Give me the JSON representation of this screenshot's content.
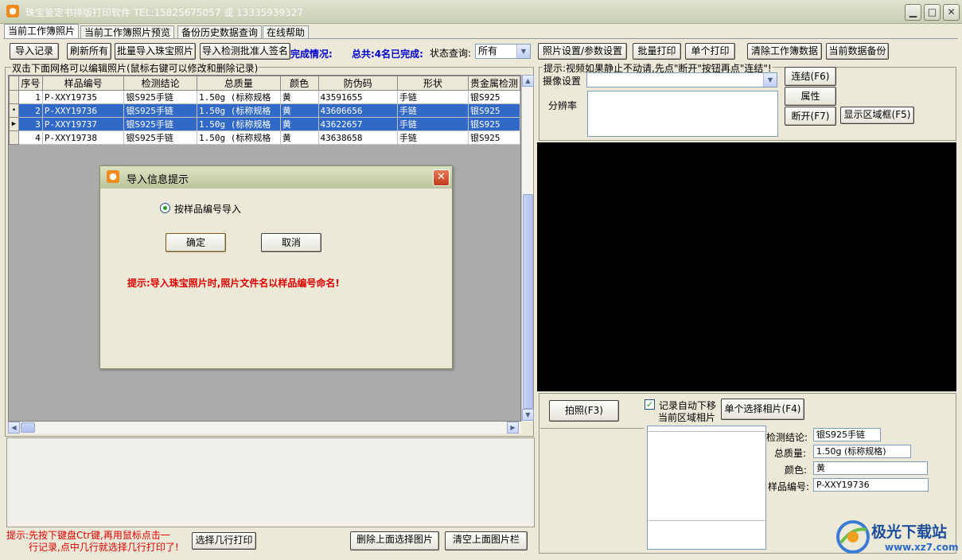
{
  "window": {
    "title": "珠宝鉴定书排版打印软件 TEL:15825675057 或 13335939327",
    "icon_name": "app-logo-icon",
    "minimize_icon": "minimize-icon",
    "maximize_icon": "maximize-icon",
    "close_icon": "close-icon"
  },
  "tabs": [
    {
      "label": "当前工作簿照片",
      "active": true
    },
    {
      "label": "当前工作簿照片预览",
      "active": false
    },
    {
      "label": "备份历史数据查询",
      "active": false
    },
    {
      "label": "在线帮助",
      "active": false
    }
  ],
  "toolbar": {
    "import_records": "导入记录",
    "refresh_all": "刷新所有",
    "batch_import_photos": "批量导入珠宝照片",
    "import_signature": "导入检测批准人签名",
    "completion_label": "完成情况:",
    "completion_status": "总共:4名已完成:",
    "status_query_label": "状态查询:",
    "status_query_value": "所有",
    "photo_settings": "照片设置/参数设置",
    "batch_print": "批量打印",
    "single_print": "单个打印",
    "clear_workbook": "清除工作簿数据",
    "backup_data": "当前数据备份"
  },
  "grid": {
    "group_label": "双击下面网格可以编辑照片(鼠标右键可以修改和删除记录)",
    "columns": [
      "序号",
      "样品编号",
      "检测结论",
      "总质量",
      "颜色",
      "防伪码",
      "形状",
      "贵金属检测"
    ],
    "rows": [
      {
        "indicator": "",
        "selected": false,
        "cells": [
          "1",
          "P-XXY19735",
          "银S925手链",
          "1.50g (标称规格",
          "黄",
          "43591655",
          "手链",
          "银S925"
        ]
      },
      {
        "indicator": "•",
        "selected": true,
        "cells": [
          "2",
          "P-XXY19736",
          "银S925手链",
          "1.50g (标称规格",
          "黄",
          "43606656",
          "手链",
          "银S925"
        ]
      },
      {
        "indicator": "▶",
        "selected": true,
        "cells": [
          "3",
          "P-XXY19737",
          "银S925手链",
          "1.50g (标称规格",
          "黄",
          "43622657",
          "手链",
          "银S925"
        ]
      },
      {
        "indicator": "",
        "selected": false,
        "cells": [
          "4",
          "P-XXY19738",
          "银S925手链",
          "1.50g (标称规格",
          "黄",
          "43638658",
          "手链",
          "银S925"
        ]
      }
    ]
  },
  "bottom_left": {
    "hint_line1": "提示:先按下键盘Ctr键,再用鼠标点击一",
    "hint_line2": "行记录,点中几行就选择几行打印了!",
    "select_rows_print": "选择几行打印",
    "delete_selected_photo": "删除上面选择图片",
    "clear_photo_bar": "清空上面图片栏"
  },
  "camera": {
    "hint": "提示:视频如果静止不动请,先点\"断开\"按钮再点\"连结\"!",
    "device_label": "摄像设置",
    "resolution_label": "分辨率",
    "connect": "连结(F6)",
    "properties": "属性",
    "disconnect": "断开(F7)",
    "show_region": "显示区域框(F5)"
  },
  "capture": {
    "take_photo": "拍照(F3)",
    "auto_move_label": "记录自动下移",
    "auto_move_checked": true,
    "current_region_label": "当前区域相片",
    "select_photo": "单个选择相片(F4)"
  },
  "detail": {
    "conclusion_label": "检测结论:",
    "conclusion_value": "银S925手链",
    "weight_label": "总质量:",
    "weight_value": "1.50g (标称规格)",
    "color_label": "颜色:",
    "color_value": "黄",
    "sample_label": "样品编号:",
    "sample_value": "P-XXY19736"
  },
  "dialog": {
    "title": "导入信息提示",
    "radio_label": "按样品编号导入",
    "radio_checked": true,
    "ok": "确定",
    "cancel": "取消",
    "hint": "提示:导入珠宝照片时,照片文件名以样品编号命名!"
  },
  "watermark": {
    "text": "极光下载站",
    "url": "www.xz7.com"
  },
  "colors": {
    "selection": "#3169c6",
    "hint_red": "#e00000",
    "status_blue": "#0000d0",
    "video_bg": "#000000"
  }
}
